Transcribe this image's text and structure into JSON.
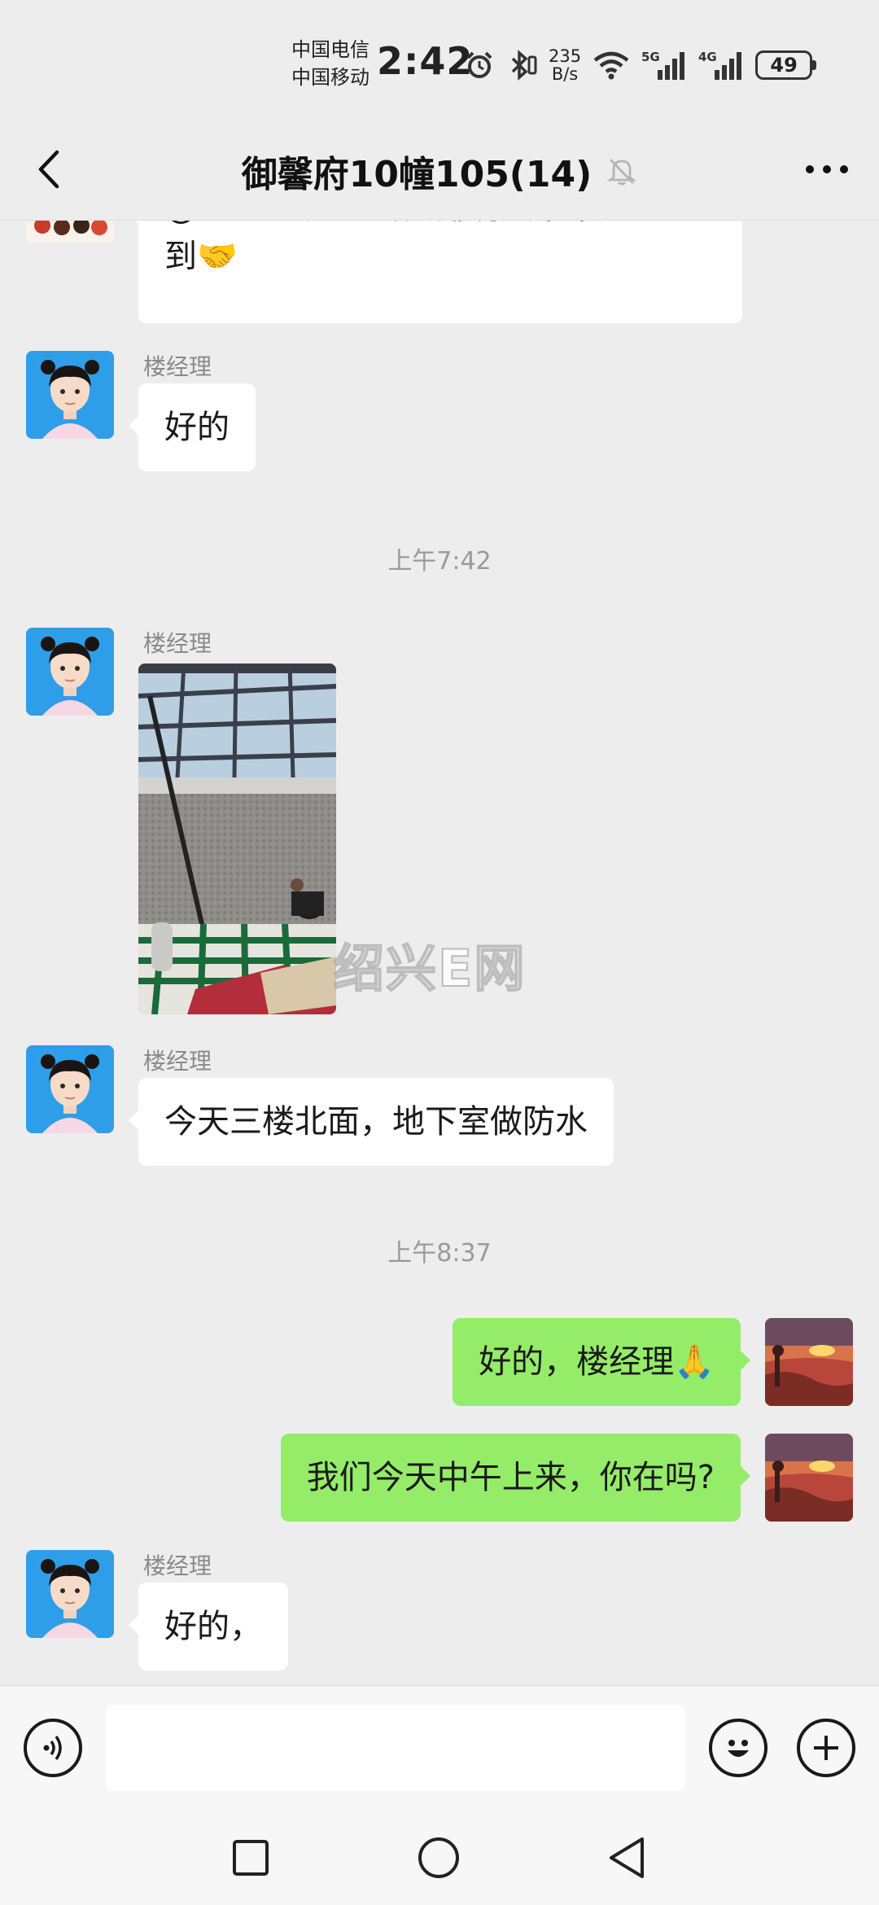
{
  "status_bar": {
    "carrier_1": "中国电信",
    "carrier_2": "中国移动",
    "time": "2:42",
    "net_speed_value": "235",
    "net_speed_unit": "B/s",
    "signal_1": "5G",
    "signal_2": "4G",
    "battery": "49",
    "icons": [
      "alarm-icon",
      "bluetooth-icon",
      "wifi-icon",
      "signal-5g-icon",
      "signal-4g-icon",
      "battery-icon"
    ]
  },
  "header": {
    "title": "御馨府10幢105(14)",
    "back_icon": "chevron-left-icon",
    "mute_icon": "bell-off-icon",
    "more_icon": "more-dots-icon"
  },
  "messages": [
    {
      "type": "text",
      "side": "left",
      "sender": "",
      "lines": [
        "@上上签  加工砖安排明天下午送",
        "到🤝"
      ]
    },
    {
      "type": "text",
      "side": "left",
      "sender": "楼经理",
      "text": "好的"
    },
    {
      "type": "time",
      "text": "上午7:42"
    },
    {
      "type": "image",
      "side": "left",
      "sender": "楼经理"
    },
    {
      "type": "text",
      "side": "left",
      "sender": "楼经理",
      "text": "今天三楼北面，地下室做防水"
    },
    {
      "type": "time",
      "text": "上午8:37"
    },
    {
      "type": "text",
      "side": "right",
      "text": "好的，楼经理🙏"
    },
    {
      "type": "text",
      "side": "right",
      "text": "我们今天中午上来，你在吗?"
    },
    {
      "type": "text",
      "side": "left",
      "sender": "楼经理",
      "text": "好的，"
    }
  ],
  "watermark": "绍兴E网",
  "input_bar": {
    "voice_icon": "voice-icon",
    "input_value": "",
    "input_placeholder": "",
    "emoji_icon": "emoji-icon",
    "plus_icon": "plus-icon"
  },
  "nav_bar": {
    "icons": [
      "recent-apps-icon",
      "home-icon",
      "back-triangle-icon"
    ]
  },
  "colors": {
    "background": "#ededed",
    "bubble_left": "#ffffff",
    "bubble_right": "#95ec69",
    "sender_gray": "#8a8a8a"
  }
}
